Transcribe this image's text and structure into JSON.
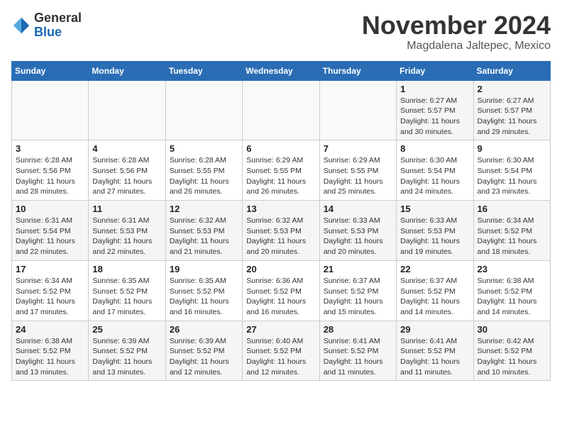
{
  "header": {
    "logo_general": "General",
    "logo_blue": "Blue",
    "month": "November 2024",
    "location": "Magdalena Jaltepec, Mexico"
  },
  "days_of_week": [
    "Sunday",
    "Monday",
    "Tuesday",
    "Wednesday",
    "Thursday",
    "Friday",
    "Saturday"
  ],
  "weeks": [
    [
      {
        "day": "",
        "info": ""
      },
      {
        "day": "",
        "info": ""
      },
      {
        "day": "",
        "info": ""
      },
      {
        "day": "",
        "info": ""
      },
      {
        "day": "",
        "info": ""
      },
      {
        "day": "1",
        "info": "Sunrise: 6:27 AM\nSunset: 5:57 PM\nDaylight: 11 hours and 30 minutes."
      },
      {
        "day": "2",
        "info": "Sunrise: 6:27 AM\nSunset: 5:57 PM\nDaylight: 11 hours and 29 minutes."
      }
    ],
    [
      {
        "day": "3",
        "info": "Sunrise: 6:28 AM\nSunset: 5:56 PM\nDaylight: 11 hours and 28 minutes."
      },
      {
        "day": "4",
        "info": "Sunrise: 6:28 AM\nSunset: 5:56 PM\nDaylight: 11 hours and 27 minutes."
      },
      {
        "day": "5",
        "info": "Sunrise: 6:28 AM\nSunset: 5:55 PM\nDaylight: 11 hours and 26 minutes."
      },
      {
        "day": "6",
        "info": "Sunrise: 6:29 AM\nSunset: 5:55 PM\nDaylight: 11 hours and 26 minutes."
      },
      {
        "day": "7",
        "info": "Sunrise: 6:29 AM\nSunset: 5:55 PM\nDaylight: 11 hours and 25 minutes."
      },
      {
        "day": "8",
        "info": "Sunrise: 6:30 AM\nSunset: 5:54 PM\nDaylight: 11 hours and 24 minutes."
      },
      {
        "day": "9",
        "info": "Sunrise: 6:30 AM\nSunset: 5:54 PM\nDaylight: 11 hours and 23 minutes."
      }
    ],
    [
      {
        "day": "10",
        "info": "Sunrise: 6:31 AM\nSunset: 5:54 PM\nDaylight: 11 hours and 22 minutes."
      },
      {
        "day": "11",
        "info": "Sunrise: 6:31 AM\nSunset: 5:53 PM\nDaylight: 11 hours and 22 minutes."
      },
      {
        "day": "12",
        "info": "Sunrise: 6:32 AM\nSunset: 5:53 PM\nDaylight: 11 hours and 21 minutes."
      },
      {
        "day": "13",
        "info": "Sunrise: 6:32 AM\nSunset: 5:53 PM\nDaylight: 11 hours and 20 minutes."
      },
      {
        "day": "14",
        "info": "Sunrise: 6:33 AM\nSunset: 5:53 PM\nDaylight: 11 hours and 20 minutes."
      },
      {
        "day": "15",
        "info": "Sunrise: 6:33 AM\nSunset: 5:53 PM\nDaylight: 11 hours and 19 minutes."
      },
      {
        "day": "16",
        "info": "Sunrise: 6:34 AM\nSunset: 5:52 PM\nDaylight: 11 hours and 18 minutes."
      }
    ],
    [
      {
        "day": "17",
        "info": "Sunrise: 6:34 AM\nSunset: 5:52 PM\nDaylight: 11 hours and 17 minutes."
      },
      {
        "day": "18",
        "info": "Sunrise: 6:35 AM\nSunset: 5:52 PM\nDaylight: 11 hours and 17 minutes."
      },
      {
        "day": "19",
        "info": "Sunrise: 6:35 AM\nSunset: 5:52 PM\nDaylight: 11 hours and 16 minutes."
      },
      {
        "day": "20",
        "info": "Sunrise: 6:36 AM\nSunset: 5:52 PM\nDaylight: 11 hours and 16 minutes."
      },
      {
        "day": "21",
        "info": "Sunrise: 6:37 AM\nSunset: 5:52 PM\nDaylight: 11 hours and 15 minutes."
      },
      {
        "day": "22",
        "info": "Sunrise: 6:37 AM\nSunset: 5:52 PM\nDaylight: 11 hours and 14 minutes."
      },
      {
        "day": "23",
        "info": "Sunrise: 6:38 AM\nSunset: 5:52 PM\nDaylight: 11 hours and 14 minutes."
      }
    ],
    [
      {
        "day": "24",
        "info": "Sunrise: 6:38 AM\nSunset: 5:52 PM\nDaylight: 11 hours and 13 minutes."
      },
      {
        "day": "25",
        "info": "Sunrise: 6:39 AM\nSunset: 5:52 PM\nDaylight: 11 hours and 13 minutes."
      },
      {
        "day": "26",
        "info": "Sunrise: 6:39 AM\nSunset: 5:52 PM\nDaylight: 11 hours and 12 minutes."
      },
      {
        "day": "27",
        "info": "Sunrise: 6:40 AM\nSunset: 5:52 PM\nDaylight: 11 hours and 12 minutes."
      },
      {
        "day": "28",
        "info": "Sunrise: 6:41 AM\nSunset: 5:52 PM\nDaylight: 11 hours and 11 minutes."
      },
      {
        "day": "29",
        "info": "Sunrise: 6:41 AM\nSunset: 5:52 PM\nDaylight: 11 hours and 11 minutes."
      },
      {
        "day": "30",
        "info": "Sunrise: 6:42 AM\nSunset: 5:52 PM\nDaylight: 11 hours and 10 minutes."
      }
    ]
  ]
}
